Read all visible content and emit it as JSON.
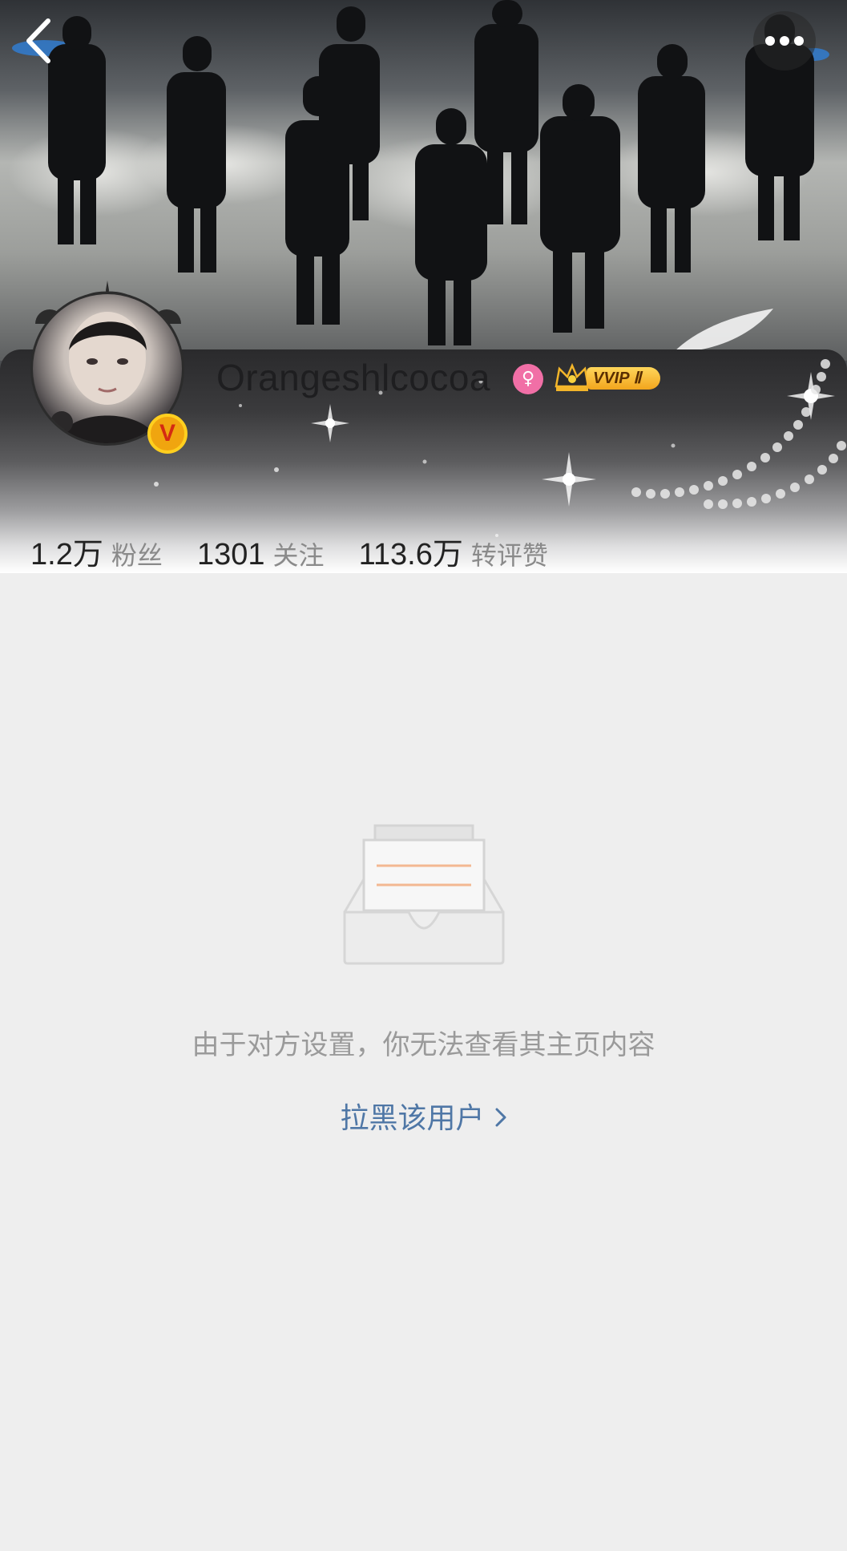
{
  "header": {
    "back_icon": "chevron-left-icon",
    "more_icon": "more-dots-icon"
  },
  "profile": {
    "username": "Orangeshlcocoa",
    "gender_icon": "female-icon",
    "gender_color": "#f16fa6",
    "vip_label": "VVIP Ⅱ",
    "verified_badge": "V"
  },
  "stats": [
    {
      "value": "1.2万",
      "label": "粉丝"
    },
    {
      "value": "1301",
      "label": "关注"
    },
    {
      "value": "113.6万",
      "label": "转评赞"
    }
  ],
  "content": {
    "empty_icon": "empty-inbox-icon",
    "notice": "由于对方设置，你无法查看其主页内容",
    "block_link": "拉黑该用户",
    "link_color": "#4f77a6"
  }
}
